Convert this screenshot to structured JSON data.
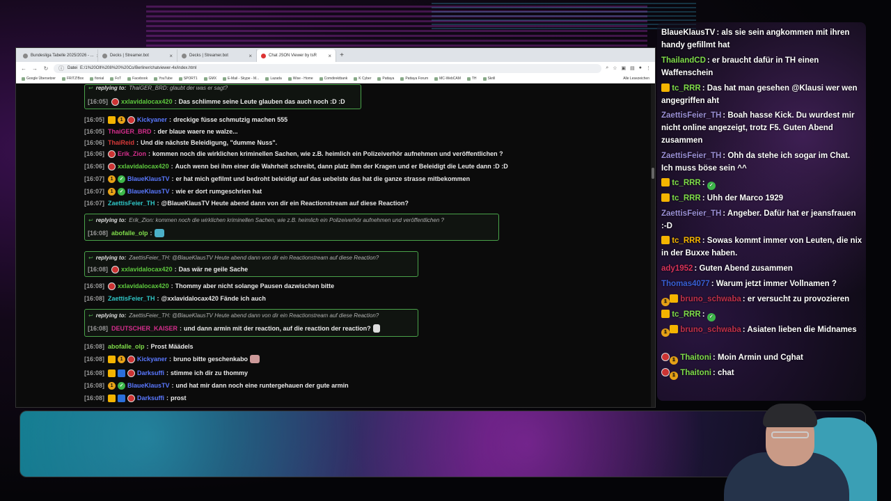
{
  "browser": {
    "tabs": [
      {
        "label": "Bundesliga Tabelle 2025/2026 - ..."
      },
      {
        "label": "Decks | Streamer.bot"
      },
      {
        "label": "Decks | Streamer.bot"
      },
      {
        "label": "Chat JSON Viewer by tsR",
        "active": true
      }
    ],
    "address_label": "Datei",
    "address": "E:/1%20OIl%208%20%20Co/Berliner/chatviewer-4x/index.html",
    "bookmarks": [
      "Google Übersetzer",
      "FRITZ!Box",
      "fionial",
      "FoT",
      "Facebook",
      "YouTube",
      "SPORT1",
      "GMX",
      "E-Mail - Skype - M...",
      "Lazada",
      "Wise - Home",
      "Comdirektbank",
      "K Cyber",
      "Pattaya",
      "Pattaya Forum",
      "MC-WebCAM",
      "TH",
      "Skrill"
    ],
    "bookmarks_right": "Alle Lesezeichen"
  },
  "chat": {
    "top_reply": {
      "context": "replying to:",
      "target": "ThaiGER_BRD: glaubt der was er sagt?"
    },
    "messages": [
      {
        "ts": "[16:05]",
        "user": "xxlavidalocax420",
        "text": "Das schlimme seine Leute glauben das auch noch :D :D"
      },
      {
        "ts": "[16:05]",
        "user": "Kickyaner",
        "text": "dreckige füsse schmutzig machen 555"
      },
      {
        "ts": "[16:05]",
        "user": "ThaiGER_BRD",
        "text": "der blaue waere ne walze..."
      },
      {
        "ts": "[16:06]",
        "user": "ThaiReid",
        "text": "Und die nächste Beleidigung, \"dumme Nuss\"."
      },
      {
        "ts": "[16:06]",
        "user": "Erik_Zion",
        "text": "kommen noch die wirklichen kriminellen Sachen, wie z.B. heimlich ein Polizeiverhör aufnehmen und veröffentlichen ?"
      },
      {
        "ts": "[16:06]",
        "user": "xxlavidalocax420",
        "text": "Auch wenn bei ihm einer die Wahrheit schreibt, dann platz ihm der Kragen und er Beleidigt die Leute dann :D :D"
      },
      {
        "ts": "[16:07]",
        "user": "BlaueKlausTV",
        "text": "er hat mich gefilmt und bedroht beleidigt auf das uebelste das hat die ganze strasse mitbekommen"
      },
      {
        "ts": "[16:07]",
        "user": "BlaueKlausTV",
        "text": "wie er dort rumgeschrien hat"
      },
      {
        "ts": "[16:07]",
        "user": "ZaettisFeier_TH",
        "text": "@BlaueKlausTV Heute abend dann von dir ein Reactionstream auf diese Reaction?"
      },
      {
        "reply": "Erik_Zion: kommen noch die wirklichen kriminellen Sachen, wie z.B. heimlich ein Polizeiverhör aufnehmen und veröffentlichen ?",
        "ts": "[16:08]",
        "user": "abofalle_olp",
        "text": ""
      },
      {
        "reply": "ZaettisFeier_TH: @BlaueKlausTV Heute abend dann von dir ein Reactionstream auf diese Reaction?",
        "ts": "[16:08]",
        "user": "xxlavidalocax420",
        "text": "Das wär ne geile Sache"
      },
      {
        "ts": "[16:08]",
        "user": "xxlavidalocax420",
        "text": "Thommy aber nicht solange Pausen dazwischen bitte"
      },
      {
        "ts": "[16:08]",
        "user": "ZaettisFeier_TH",
        "text": "@xxlavidalocax420 Fände ich auch"
      },
      {
        "reply": "ZaettisFeier_TH: @BlaueKlausTV Heute abend dann von dir ein Reactionstream auf diese Reaction?",
        "ts": "[16:08]",
        "user": "DEUTSCHER_KAISER",
        "text": "und dann armin mit der reaction, auf die reaction der reaction?"
      },
      {
        "ts": "[16:08]",
        "user": "abofalle_olp",
        "text": "Prost Määdels"
      },
      {
        "ts": "[16:08]",
        "user": "Kickyaner",
        "text": "bruno bitte geschenkabo"
      },
      {
        "ts": "[16:08]",
        "user": "Darksuffi",
        "text": "stimme ich dir zu thommy"
      },
      {
        "ts": "[16:08]",
        "user": "BlaueKlausTV",
        "text": "und hat mir dann noch eine runtergehauen der gute armin"
      },
      {
        "ts": "[16:08]",
        "user": "Darksuffi",
        "text": "prost"
      }
    ],
    "reply_prefix": "replying to:"
  },
  "overlay": {
    "messages": [
      {
        "user": "BlaueKlausTV",
        "text": "als sie sein angkommen mit ihren handy gefillmt hat"
      },
      {
        "user": "ThailandCD",
        "text": "er braucht dafür in TH einen Waffenschein"
      },
      {
        "user": "tc_RRR",
        "text": "Das hat man gesehen @Klausi wer wen angegriffen aht"
      },
      {
        "user": "ZaettisFeier_TH",
        "text": "Boah hasse Kick. Du wurdest mir nicht online angezeigt, trotz F5. Guten Abend zusammen"
      },
      {
        "user": "ZaettisFeier_TH",
        "text": "Ohh da stehe ich sogar im Chat. Ich muss böse sein ^^"
      },
      {
        "user": "tc_RRR",
        "text": ""
      },
      {
        "user": "tc_RRR",
        "text": "Uhh der Marco 1929"
      },
      {
        "user": "ZaettisFeier_TH",
        "text": "Angeber. Dafür hat er jeansfrauen :-D"
      },
      {
        "user": "tc_RRR",
        "text": "Sowas kommt immer von Leuten, die nix in der Buxxe haben."
      },
      {
        "user": "ady1952",
        "text": "Guten Abend zusammen"
      },
      {
        "user": "Thomas4077",
        "text": "Warum jetzt immer Vollnamen ?"
      },
      {
        "user": "bruno_schwaba",
        "text": "er versucht zu provozieren"
      },
      {
        "user": "tc_RRR",
        "text": ""
      },
      {
        "user": "bruno_schwaba",
        "text": "Asiaten lieben die Midnames"
      },
      {
        "user": "Thaitoni",
        "text": "Moin Armin und Cghat"
      },
      {
        "user": "Thaitoni",
        "text": "chat"
      }
    ]
  },
  "colors": {
    "reply_border": "#4aa34a",
    "accent_purple": "#8a3fd1"
  }
}
